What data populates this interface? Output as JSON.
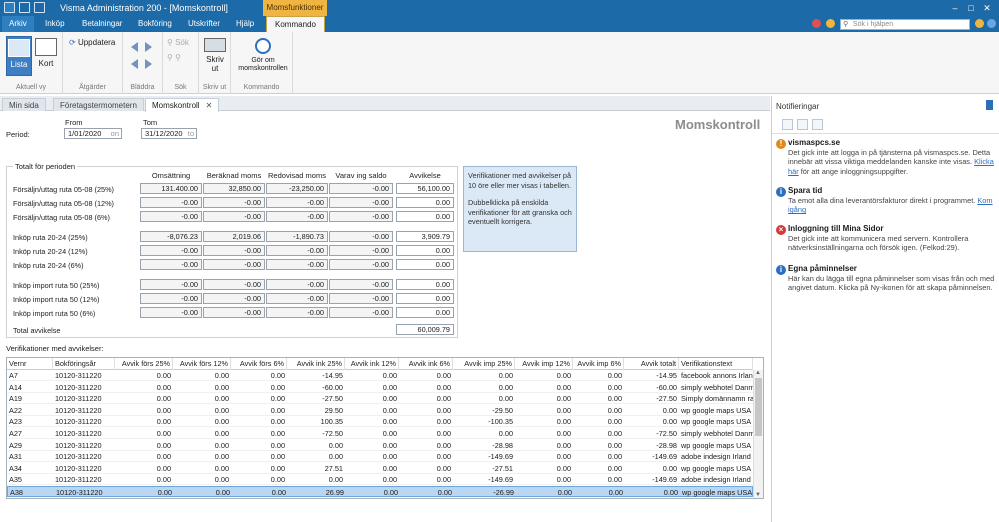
{
  "window": {
    "title": "Visma Administration 200 - [Momskontroll]",
    "context_tab": "Momsfunktioner"
  },
  "menu": {
    "items": [
      "Arkiv",
      "Inköp",
      "Betalningar",
      "Bokföring",
      "Utskrifter",
      "Hjälp",
      "Kommando"
    ],
    "active": "Kommando"
  },
  "help_search": {
    "placeholder": "Sök i hjälpen"
  },
  "ribbon": {
    "groups": [
      {
        "label": "Aktuell vy",
        "buttons": [
          "Lista",
          "Kort"
        ]
      },
      {
        "label": "Åtgärder",
        "buttons": [
          "Uppdatera"
        ]
      },
      {
        "label": "Bläddra",
        "buttons": []
      },
      {
        "label": "Sök",
        "buttons": [
          "Sök"
        ]
      },
      {
        "label": "Skriv ut",
        "buttons": [
          "Skriv ut"
        ]
      },
      {
        "label": "Kommando",
        "buttons": [
          "Gör om momskontrollen"
        ]
      }
    ]
  },
  "tabs": [
    {
      "label": "Min sida"
    },
    {
      "label": "Företagstermometern"
    },
    {
      "label": "Momskontroll"
    }
  ],
  "period": {
    "label": "Period:",
    "from_label": "From",
    "to_label": "Tom",
    "from_value": "1/01/2020",
    "to_value": "31/12/2020",
    "from_suffix": "on",
    "to_suffix": "to"
  },
  "page_title": "Momskontroll",
  "totals": {
    "group_title": "Totalt för perioden",
    "columns": [
      "Omsättning",
      "Beräknad moms",
      "Redovisad moms",
      "Varav ing saldo",
      "Avvikelse"
    ],
    "rows": [
      {
        "label": "Försäljn/uttag ruta 05-08 (25%)",
        "values": [
          "131.400.00",
          "32,850.00",
          "-23,250.00",
          "-0.00",
          "56,100.00"
        ]
      },
      {
        "label": "Försäljn/uttag ruta 05-08 (12%)",
        "values": [
          "-0.00",
          "-0.00",
          "-0.00",
          "-0.00",
          "0.00"
        ]
      },
      {
        "label": "Försäljn/uttag ruta 05-08 (6%)",
        "values": [
          "-0.00",
          "-0.00",
          "-0.00",
          "-0.00",
          "0.00"
        ]
      },
      {
        "label": "Inköp ruta 20-24 (25%)",
        "values": [
          "-8,076.23",
          "2,019.06",
          "-1,890.73",
          "-0.00",
          "3,909.79"
        ]
      },
      {
        "label": "Inköp ruta 20-24 (12%)",
        "values": [
          "-0.00",
          "-0.00",
          "-0.00",
          "-0.00",
          "0.00"
        ]
      },
      {
        "label": "Inköp ruta 20-24 (6%)",
        "values": [
          "-0.00",
          "-0.00",
          "-0.00",
          "-0.00",
          "0.00"
        ]
      },
      {
        "label": "Inköp import ruta 50 (25%)",
        "values": [
          "-0.00",
          "-0.00",
          "-0.00",
          "-0.00",
          "0.00"
        ]
      },
      {
        "label": "Inköp import ruta 50 (12%)",
        "values": [
          "-0.00",
          "-0.00",
          "-0.00",
          "-0.00",
          "0.00"
        ]
      },
      {
        "label": "Inköp import ruta 50 (6%)",
        "values": [
          "-0.00",
          "-0.00",
          "-0.00",
          "-0.00",
          "0.00"
        ]
      }
    ],
    "total_label": "Total avvikelse",
    "total_value": "60,009.79"
  },
  "info_box": {
    "p1": "Verifikationer med avvikelser på 10 öre eller mer visas i tabellen.",
    "p2": "Dubbelklicka på enskilda verifikationer för att granska och eventuellt korrigera."
  },
  "ver_label": "Verifikationer med avvikelser:",
  "grid": {
    "columns": [
      "Vernr",
      "Bokföringsår",
      "Avvik förs 25%",
      "Avvik förs 12%",
      "Avvik förs 6%",
      "Avvik ink 25%",
      "Avvik ink 12%",
      "Avvik ink 6%",
      "Avvik imp 25%",
      "Avvik imp 12%",
      "Avvik imp 6%",
      "Avvik totalt",
      "Verifikationstext"
    ],
    "rows": [
      [
        "A7",
        "10120-311220",
        "0.00",
        "0.00",
        "0.00",
        "-14.95",
        "0.00",
        "0.00",
        "0.00",
        "0.00",
        "0.00",
        "-14.95",
        "facebook annons Irland"
      ],
      [
        "A14",
        "10120-311220",
        "0.00",
        "0.00",
        "0.00",
        "-60.00",
        "0.00",
        "0.00",
        "0.00",
        "0.00",
        "0.00",
        "-60.00",
        "simply webhotel Danmark"
      ],
      [
        "A19",
        "10120-311220",
        "0.00",
        "0.00",
        "0.00",
        "-27.50",
        "0.00",
        "0.00",
        "0.00",
        "0.00",
        "0.00",
        "-27.50",
        "Simply domännamn raderat"
      ],
      [
        "A22",
        "10120-311220",
        "0.00",
        "0.00",
        "0.00",
        "29.50",
        "0.00",
        "0.00",
        "-29.50",
        "0.00",
        "0.00",
        "0.00",
        "wp google maps USA"
      ],
      [
        "A23",
        "10120-311220",
        "0.00",
        "0.00",
        "0.00",
        "100.35",
        "0.00",
        "0.00",
        "-100.35",
        "0.00",
        "0.00",
        "0.00",
        "wp google maps USA"
      ],
      [
        "A27",
        "10120-311220",
        "0.00",
        "0.00",
        "0.00",
        "-72.50",
        "0.00",
        "0.00",
        "0.00",
        "0.00",
        "0.00",
        "-72.50",
        "simply webhotel Danmark"
      ],
      [
        "A29",
        "10120-311220",
        "0.00",
        "0.00",
        "0.00",
        "0.00",
        "0.00",
        "0.00",
        "-28.98",
        "0.00",
        "0.00",
        "-28.98",
        "wp google maps USA"
      ],
      [
        "A31",
        "10120-311220",
        "0.00",
        "0.00",
        "0.00",
        "0.00",
        "0.00",
        "0.00",
        "-149.69",
        "0.00",
        "0.00",
        "-149.69",
        "adobe indesign Irland"
      ],
      [
        "A34",
        "10120-311220",
        "0.00",
        "0.00",
        "0.00",
        "27.51",
        "0.00",
        "0.00",
        "-27.51",
        "0.00",
        "0.00",
        "0.00",
        "wp google maps USA"
      ],
      [
        "A35",
        "10120-311220",
        "0.00",
        "0.00",
        "0.00",
        "0.00",
        "0.00",
        "0.00",
        "-149.69",
        "0.00",
        "0.00",
        "-149.69",
        "adobe indesign Irland"
      ],
      [
        "A38",
        "10120-311220",
        "0.00",
        "0.00",
        "0.00",
        "26.99",
        "0.00",
        "0.00",
        "-26.99",
        "0.00",
        "0.00",
        "0.00",
        "wp google maps USA"
      ]
    ],
    "selected_row": 10
  },
  "notifications": {
    "header": "Notifieringar",
    "items": [
      {
        "icon": "warning-icon",
        "color": "#e08a1e",
        "title": "vismaspcs.se",
        "body": "Det gick inte att logga in på tjänsterna på vismaspcs.se. Detta innebär att vissa viktiga meddelanden kanske inte visas.",
        "link": "Klicka här",
        "tail": "för att ange inloggningsuppgifter."
      },
      {
        "icon": "info-icon",
        "color": "#2b6fc2",
        "title": "Spara tid",
        "body": "Ta emot alla dina leverantörsfakturor direkt i programmet.",
        "link": "Kom igång",
        "tail": ""
      },
      {
        "icon": "error-icon",
        "color": "#d23b3b",
        "title": "Inloggning till Mina Sidor",
        "body": "Det gick inte att kommunicera med servern. Kontrollera nätverksinställningarna och försök igen. (Felkod:29).",
        "link": "",
        "tail": ""
      },
      {
        "icon": "info-icon",
        "color": "#2b6fc2",
        "title": "Egna påminnelser",
        "body": "Här kan du lägga till egna påminnelser som visas från och med angivet datum. Klicka på Ny-ikonen för att skapa påminnelsen.",
        "link": "",
        "tail": ""
      }
    ]
  }
}
